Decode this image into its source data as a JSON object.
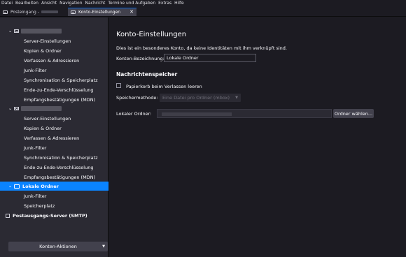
{
  "menubar": [
    "Datei",
    "Bearbeiten",
    "Ansicht",
    "Navigation",
    "Nachricht",
    "Termine und Aufgaben",
    "Extras",
    "Hilfe"
  ],
  "tabs": [
    {
      "label": "Posteingang -",
      "active": false
    },
    {
      "label": "Konto-Einstellungen",
      "active": true
    }
  ],
  "sidebar": {
    "account1_items": [
      "Server-Einstellungen",
      "Kopien & Ordner",
      "Verfassen & Adressieren",
      "Junk-Filter",
      "Synchronisation & Speicherplatz",
      "Ende-zu-Ende-Verschlüsselung",
      "Empfangsbestätigungen (MDN)"
    ],
    "account2_items": [
      "Server-Einstellungen",
      "Kopien & Ordner",
      "Verfassen & Adressieren",
      "Junk-Filter",
      "Synchronisation & Speicherplatz",
      "Ende-zu-Ende-Verschlüsselung",
      "Empfangsbestätigungen (MDN)"
    ],
    "local_folders": "Lokale Ordner",
    "local_items": [
      "Junk-Filter",
      "Speicherplatz"
    ],
    "smtp": "Postausgangs-Server (SMTP)",
    "account_actions": "Konten-Aktionen"
  },
  "main": {
    "title": "Konto-Einstellungen",
    "description": "Dies ist ein besonderes Konto, da keine Identitäten mit ihm verknüpft sind.",
    "account_name_label": "Konten-Bezeichnung:",
    "account_name_value": "Lokale Ordner",
    "section_title": "Nachrichtenspeicher",
    "empty_trash_label": "Papierkorb beim Verlassen leeren",
    "storage_method_label": "Speichermethode:",
    "storage_method_value": "Eine Datei pro Ordner (mbox)",
    "local_folder_label": "Lokaler Ordner:",
    "browse_button": "Ordner wählen..."
  },
  "colors": {
    "accent": "#0a84ff",
    "sidebar_bg": "#2b2a33",
    "main_bg": "#1c1b22"
  }
}
